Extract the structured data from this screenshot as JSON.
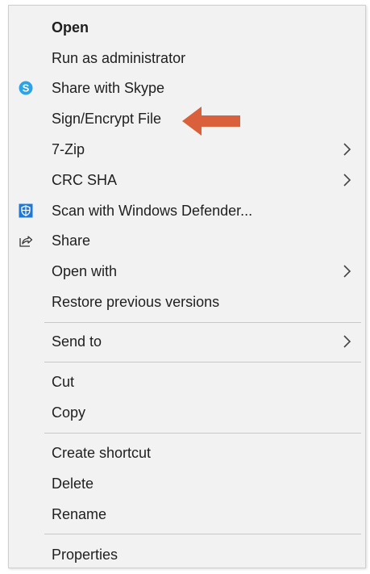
{
  "menu": {
    "items": [
      {
        "label": "Open"
      },
      {
        "label": "Run as administrator"
      },
      {
        "label": "Share with Skype",
        "icon": "skype-icon"
      },
      {
        "label": "Sign/Encrypt File"
      },
      {
        "label": "7-Zip",
        "submenu": true
      },
      {
        "label": "CRC SHA",
        "submenu": true
      },
      {
        "label": "Scan with Windows Defender...",
        "icon": "windows-defender-icon"
      },
      {
        "label": "Share",
        "icon": "share-icon"
      },
      {
        "label": "Open with",
        "submenu": true
      },
      {
        "label": "Restore previous versions"
      },
      {
        "label": "Send to",
        "submenu": true
      },
      {
        "label": "Cut"
      },
      {
        "label": "Copy"
      },
      {
        "label": "Create shortcut"
      },
      {
        "label": "Delete"
      },
      {
        "label": "Rename"
      },
      {
        "label": "Properties"
      }
    ]
  },
  "colors": {
    "menu_background": "#f2f2f2",
    "highlight_arrow": "#d9603a",
    "skype_blue": "#2aa3e8",
    "defender_blue": "#1e78d7"
  }
}
